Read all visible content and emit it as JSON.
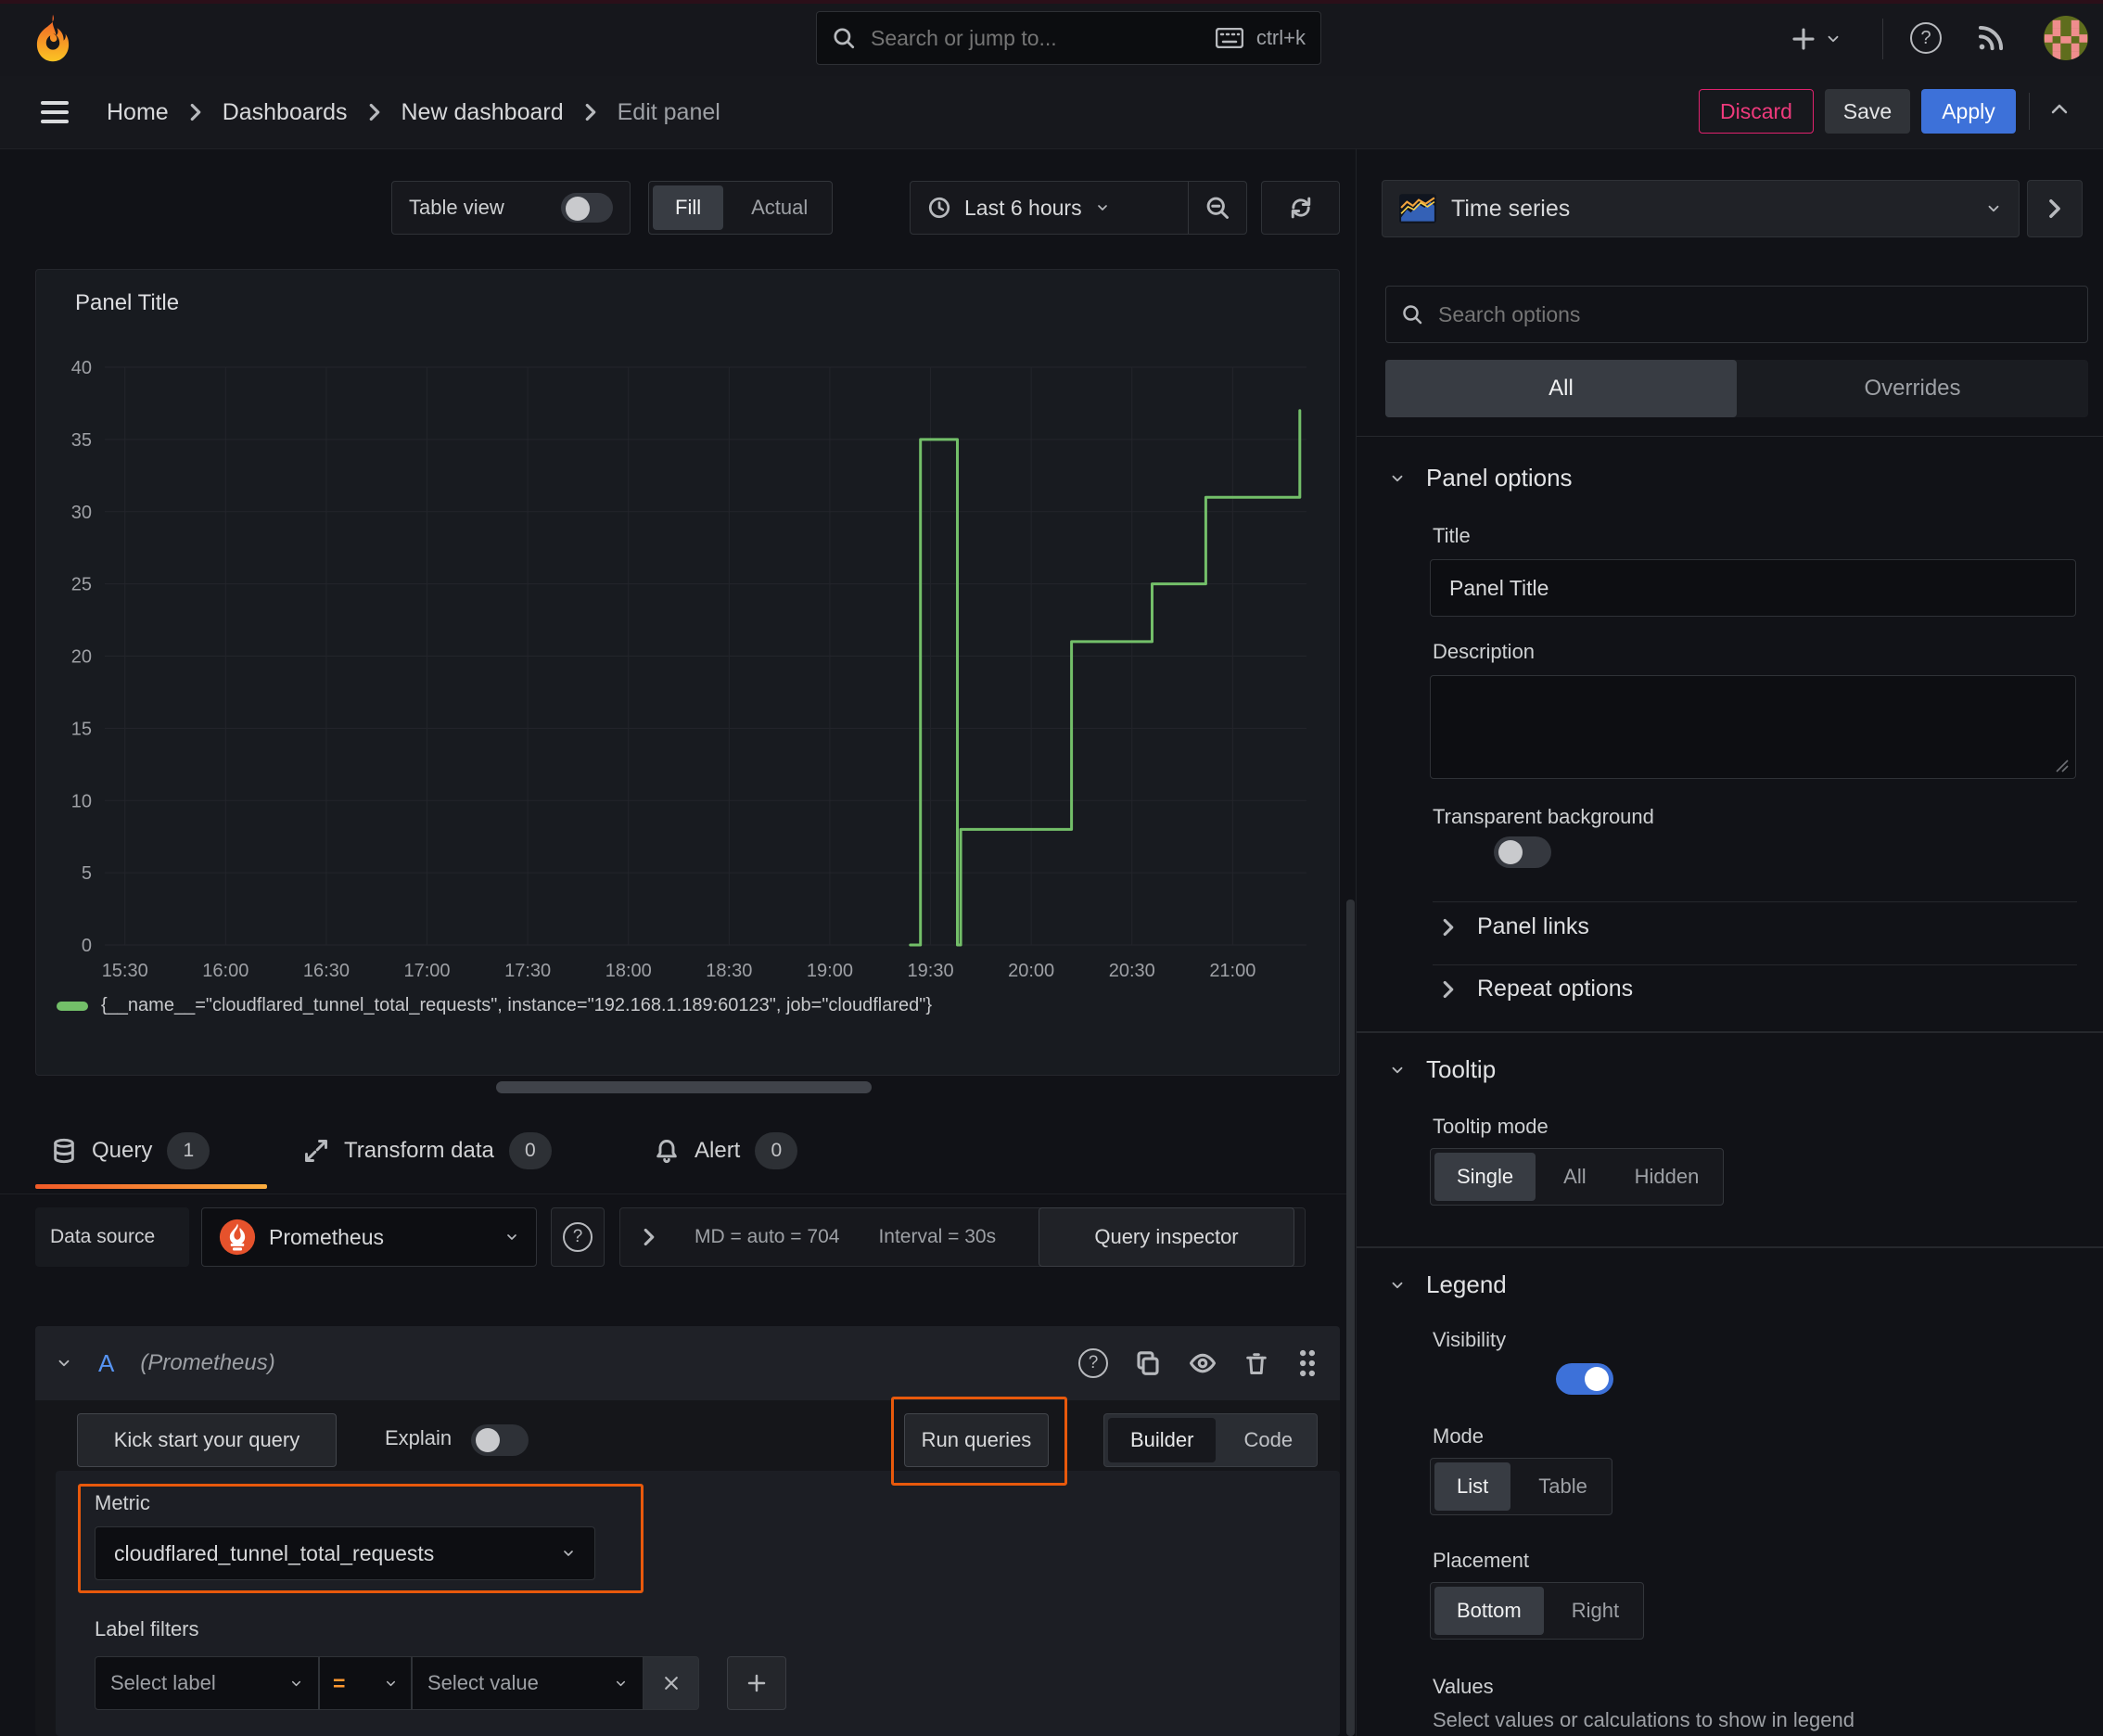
{
  "colors": {
    "accent_orange": "#e8590c",
    "series_green": "#73bf69",
    "primary_blue": "#3d71d9",
    "danger_pink": "#e0226e"
  },
  "topnav": {
    "search_placeholder": "Search or jump to...",
    "search_shortcut": "ctrl+k"
  },
  "breadcrumb": {
    "items": [
      "Home",
      "Dashboards",
      "New dashboard",
      "Edit panel"
    ]
  },
  "header_actions": {
    "discard": "Discard",
    "save": "Save",
    "apply": "Apply"
  },
  "toolbar": {
    "table_view_label": "Table view",
    "view_modes": [
      "Fill",
      "Actual"
    ],
    "selected_view_mode": "Fill",
    "time_range": "Last 6 hours"
  },
  "panel": {
    "title": "Panel Title"
  },
  "chart_data": {
    "type": "line",
    "line_interpolation": "step-after",
    "title": "Panel Title",
    "xlabel": "",
    "ylabel": "",
    "x_start": "15:24",
    "x_end": "21:22",
    "x_ticks": [
      "15:30",
      "16:00",
      "16:30",
      "17:00",
      "17:30",
      "18:00",
      "18:30",
      "19:00",
      "19:30",
      "20:00",
      "20:30",
      "21:00"
    ],
    "ylim": [
      0,
      40
    ],
    "y_ticks": [
      0,
      5,
      10,
      15,
      20,
      25,
      30,
      35,
      40
    ],
    "grid": true,
    "legend_position": "bottom",
    "series": [
      {
        "name": "{__name__=\"cloudflared_tunnel_total_requests\", instance=\"192.168.1.189:60123\", job=\"cloudflared\"}",
        "color": "#73bf69",
        "points": [
          [
            "19:24",
            0
          ],
          [
            "19:27",
            35
          ],
          [
            "19:38",
            0
          ],
          [
            "19:39",
            8
          ],
          [
            "20:12",
            21
          ],
          [
            "20:36",
            25
          ],
          [
            "20:52",
            31
          ],
          [
            "21:20",
            37
          ]
        ]
      }
    ]
  },
  "query_tabs": {
    "query_label": "Query",
    "query_count": "1",
    "transform_label": "Transform data",
    "transform_count": "0",
    "alert_label": "Alert",
    "alert_count": "0"
  },
  "datasource_row": {
    "label": "Data source",
    "name": "Prometheus",
    "stats": "MD = auto = 704",
    "interval": "Interval = 30s",
    "query_inspector": "Query inspector"
  },
  "query_editor": {
    "ref_id": "A",
    "datasource_hint": "(Prometheus)",
    "kick_start": "Kick start your query",
    "explain_label": "Explain",
    "run_queries": "Run queries",
    "editor_modes": [
      "Builder",
      "Code"
    ],
    "metric_label": "Metric",
    "metric_value": "cloudflared_tunnel_total_requests",
    "label_filters_label": "Label filters",
    "select_label_placeholder": "Select label",
    "operator": "=",
    "select_value_placeholder": "Select value"
  },
  "options_pane": {
    "visualization": "Time series",
    "search_placeholder": "Search options",
    "tabs": [
      "All",
      "Overrides"
    ],
    "panel_options": {
      "header": "Panel options",
      "title_label": "Title",
      "title_value": "Panel Title",
      "description_label": "Description",
      "transparent_label": "Transparent background"
    },
    "panel_links_label": "Panel links",
    "repeat_options_label": "Repeat options",
    "tooltip": {
      "header": "Tooltip",
      "mode_label": "Tooltip mode",
      "modes": [
        "Single",
        "All",
        "Hidden"
      ]
    },
    "legend": {
      "header": "Legend",
      "visibility_label": "Visibility",
      "mode_label": "Mode",
      "modes": [
        "List",
        "Table"
      ],
      "placement_label": "Placement",
      "placements": [
        "Bottom",
        "Right"
      ],
      "values_label": "Values",
      "values_help": "Select values or calculations to show in legend"
    }
  }
}
